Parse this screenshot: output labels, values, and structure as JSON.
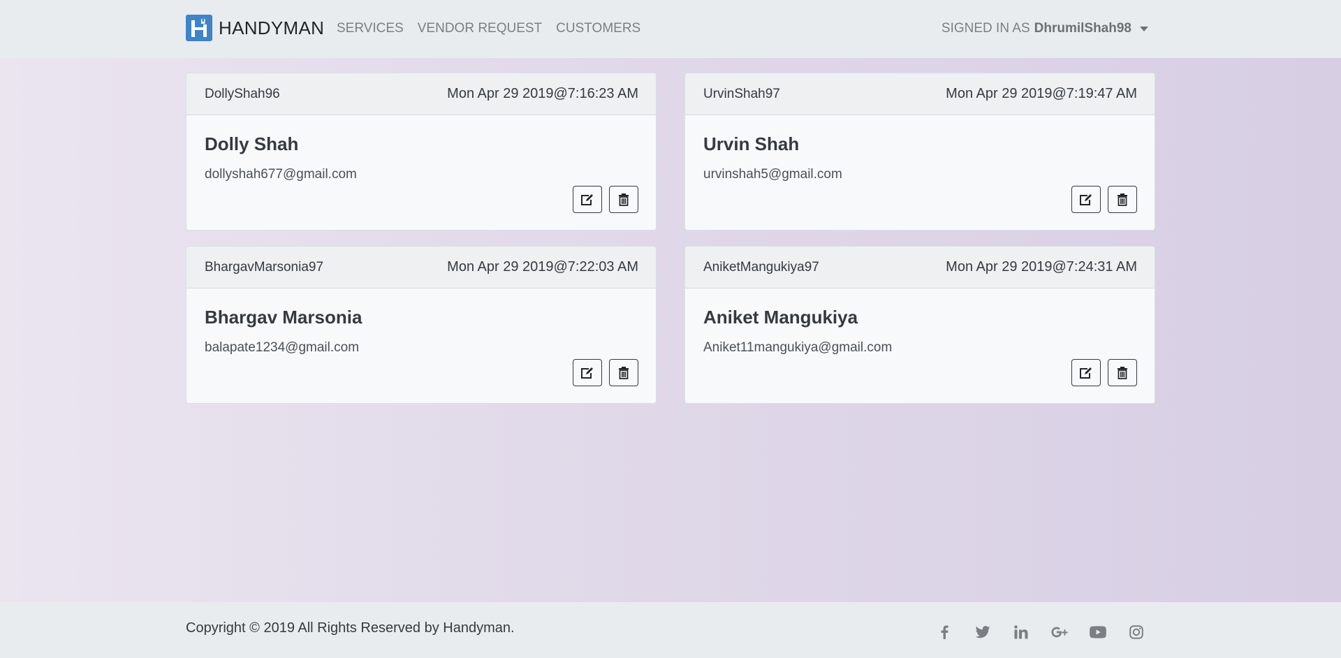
{
  "navbar": {
    "brand_name": "HANDYMAN",
    "links": [
      "SERVICES",
      "VENDOR REQUEST",
      "CUSTOMERS"
    ],
    "signed_in_label": "SIGNED IN AS",
    "username": "DhrumilShah98"
  },
  "customers": [
    {
      "username": "DollyShah96",
      "date": "Mon Apr 29 2019@7:16:23 AM",
      "name": "Dolly Shah",
      "email": "dollyshah677@gmail.com"
    },
    {
      "username": "UrvinShah97",
      "date": "Mon Apr 29 2019@7:19:47 AM",
      "name": "Urvin Shah",
      "email": "urvinshah5@gmail.com"
    },
    {
      "username": "BhargavMarsonia97",
      "date": "Mon Apr 29 2019@7:22:03 AM",
      "name": "Bhargav Marsonia",
      "email": "balapate1234@gmail.com"
    },
    {
      "username": "AniketMangukiya97",
      "date": "Mon Apr 29 2019@7:24:31 AM",
      "name": "Aniket Mangukiya",
      "email": "Aniket11mangukiya@gmail.com"
    }
  ],
  "footer": {
    "copyright": "Copyright © 2019 All Rights Reserved by Handyman.",
    "social_icons": [
      "facebook-icon",
      "twitter-icon",
      "linkedin-icon",
      "google-plus-icon",
      "youtube-icon",
      "instagram-icon"
    ]
  },
  "colors": {
    "brand_logo": "#3e84c6",
    "navbar_bg": "#e9ecef",
    "card_bg": "#f8f9fa",
    "text_dark": "#343a40",
    "nav_text": "#7a7f85"
  }
}
